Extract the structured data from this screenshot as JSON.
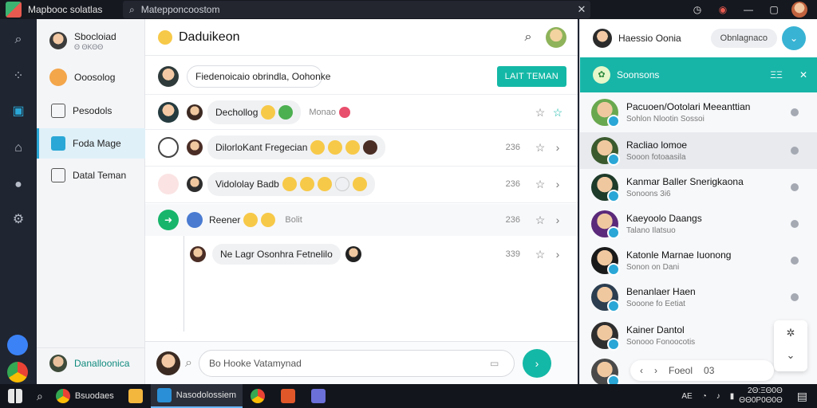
{
  "titlebar": {
    "title": "Mapbooc solatlas",
    "search_text": "Matepponcoostom",
    "close": "✕",
    "icons": [
      "clock-icon",
      "record-icon",
      "maximize-icon",
      "close-window-icon"
    ]
  },
  "sidebar": {
    "profile_name": "Sbocloiad",
    "profile_sub": "Θ ΘΚΘΘ",
    "items": [
      {
        "label": "Ooosolog",
        "icon": "emoji-icon"
      },
      {
        "label": "Pesodols",
        "icon": "list-icon"
      },
      {
        "label": "Foda Mage",
        "icon": "image-icon",
        "active": true
      },
      {
        "label": "Datal Teman",
        "icon": "document-icon"
      }
    ],
    "footer_name": "Danalloonica"
  },
  "main": {
    "title": "Daduikeon",
    "compose_top": "Fiedenoicaio obrindla, Oohonke",
    "compose_button": "LAIT TEMAN",
    "messages": [
      {
        "text": "Dechollog",
        "meta": "Monao",
        "time": ""
      },
      {
        "text": "DilorloKant Fregecian",
        "meta": "",
        "time": "236"
      },
      {
        "text": "Vidololay Badb",
        "meta": "",
        "time": "236"
      },
      {
        "text": "Reener",
        "meta": "Bolit",
        "time": "236"
      },
      {
        "text": "Ne Lagr Osonhra Fetnelilo",
        "meta": "",
        "time": "339"
      }
    ],
    "composer_placeholder": "Bo Hooke Vatamynad"
  },
  "right": {
    "header_name": "Haessio Oonia",
    "chip": "Obnlagnaco",
    "banner": "Soonsons",
    "banner_code": "ΞΞ",
    "contacts": [
      {
        "name": "Pacuoen/Ootolari Meeanttian",
        "sub": "Sohlon  Nlootin Sossoi"
      },
      {
        "name": "Racliao lomoe",
        "sub": "Sooon fotoaasila"
      },
      {
        "name": "Kanmar Baller Snerigkaona",
        "sub": "Sonoons 3i6"
      },
      {
        "name": "Kaeyoolo Daangs",
        "sub": "Talano Ilatsuo"
      },
      {
        "name": "Katonle Marnae Iuonong",
        "sub": "Sonon on Dani"
      },
      {
        "name": "Benanlaer Haen",
        "sub": "Sooone fo Eetiat"
      },
      {
        "name": "Kainer Dantol",
        "sub": "Sonooo Fonoocotis"
      }
    ],
    "pager_label": "Foeol",
    "pager_page": "03"
  },
  "taskbar": {
    "apps": [
      "Bsuodaes",
      "Nasodolossiem"
    ],
    "tray_lang": "AE",
    "clock_time": "2Θ:ΞΘ0Θ",
    "clock_date": "ΘΘ0Ρ0Θ0Θ"
  },
  "colors": {
    "accent": "#14b8a6",
    "link": "#2aa7d6",
    "rail": "#1f2531"
  }
}
